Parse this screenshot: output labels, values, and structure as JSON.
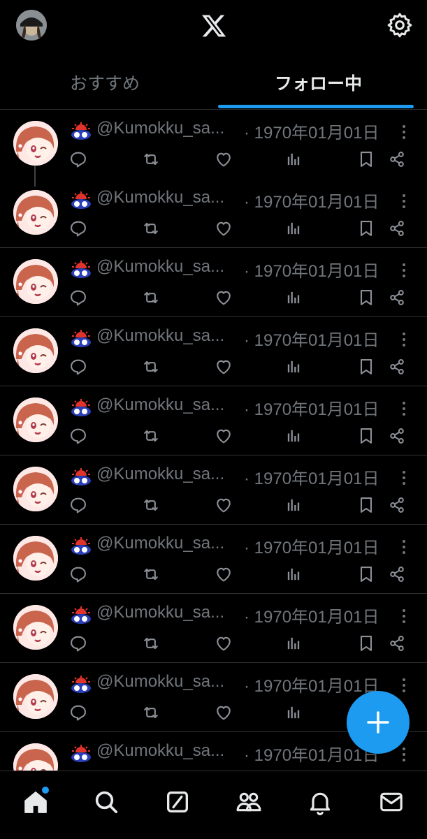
{
  "tabs": {
    "recommended": "おすすめ",
    "following": "フォロー中"
  },
  "posts": [
    {
      "handle": "@Kumokku_sa...",
      "date": "· 1970年01月01日"
    },
    {
      "handle": "@Kumokku_sa...",
      "date": "· 1970年01月01日"
    },
    {
      "handle": "@Kumokku_sa...",
      "date": "· 1970年01月01日"
    },
    {
      "handle": "@Kumokku_sa...",
      "date": "· 1970年01月01日"
    },
    {
      "handle": "@Kumokku_sa...",
      "date": "· 1970年01月01日"
    },
    {
      "handle": "@Kumokku_sa...",
      "date": "· 1970年01月01日"
    },
    {
      "handle": "@Kumokku_sa...",
      "date": "· 1970年01月01日"
    },
    {
      "handle": "@Kumokku_sa...",
      "date": "· 1970年01月01日"
    },
    {
      "handle": "@Kumokku_sa...",
      "date": "· 1970年01月01日"
    },
    {
      "handle": "@Kumokku_sa...",
      "date": "· 1970年01月01日"
    }
  ],
  "colors": {
    "accent": "#1d9bf0",
    "background": "#000000",
    "muted_text": "#71767b",
    "divider": "#2f3336"
  },
  "icons": {
    "top": [
      "profile-avatar",
      "x-logo-icon",
      "settings-gear-icon"
    ],
    "post_actions": [
      "reply-icon",
      "repost-icon",
      "like-icon",
      "views-icon",
      "bookmark-icon",
      "share-icon"
    ],
    "bottom_nav": [
      "home-icon",
      "search-icon",
      "grok-icon",
      "communities-icon",
      "notifications-icon",
      "messages-icon"
    ],
    "fab": "compose-plus-icon"
  }
}
